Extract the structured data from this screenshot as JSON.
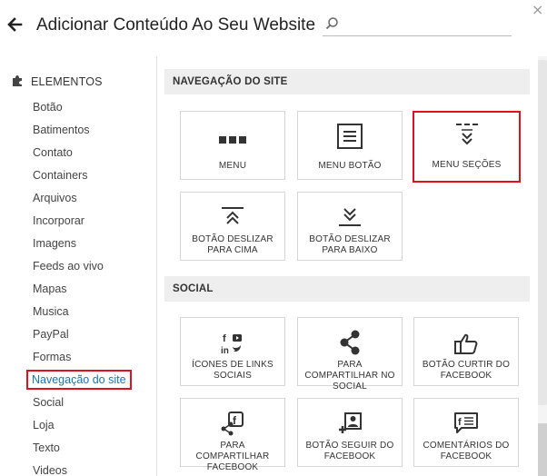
{
  "header": {
    "title": "Adicionar Conteúdo Ao Seu Website",
    "search_placeholder": "",
    "search_value": ""
  },
  "sidebar": {
    "header": "ELEMENTOS",
    "items": [
      {
        "label": "Botão"
      },
      {
        "label": "Batimentos"
      },
      {
        "label": "Contato"
      },
      {
        "label": "Containers"
      },
      {
        "label": "Arquivos"
      },
      {
        "label": "Incorporar"
      },
      {
        "label": "Imagens"
      },
      {
        "label": "Feeds ao vivo"
      },
      {
        "label": "Mapas"
      },
      {
        "label": "Musica"
      },
      {
        "label": "PayPal"
      },
      {
        "label": "Formas"
      },
      {
        "label": "Navegação do site",
        "active": true
      },
      {
        "label": "Social"
      },
      {
        "label": "Loja"
      },
      {
        "label": "Texto"
      },
      {
        "label": "Videos"
      }
    ]
  },
  "sections": {
    "nav": {
      "title": "NAVEGAÇÃO DO SITE",
      "cards": [
        {
          "label": "MENU",
          "icon": "menu-dots-icon"
        },
        {
          "label": "MENU BOTÃO",
          "icon": "menu-button-icon"
        },
        {
          "label": "MENU SEÇÕES",
          "icon": "menu-sections-icon"
        },
        {
          "label": "BOTÃO DESLIZAR PARA CIMA",
          "icon": "scroll-up-icon"
        },
        {
          "label": "BOTÃO DESLIZAR PARA BAIXO",
          "icon": "scroll-down-icon"
        }
      ]
    },
    "social": {
      "title": "SOCIAL",
      "cards": [
        {
          "label": "ÍCONES DE LINKS SOCIAIS",
          "icon": "social-links-icon"
        },
        {
          "label": "PARA COMPARTILHAR NO SOCIAL",
          "icon": "share-icon"
        },
        {
          "label": "BOTÃO CURTIR DO FACEBOOK",
          "icon": "thumbs-up-icon"
        },
        {
          "label": "PARA COMPARTILHAR FACEBOOK",
          "icon": "facebook-share-icon"
        },
        {
          "label": "BOTÃO SEGUIR DO FACEBOOK",
          "icon": "facebook-follow-icon"
        },
        {
          "label": "COMENTÁRIOS DO FACEBOOK",
          "icon": "facebook-comments-icon"
        }
      ]
    }
  },
  "colors": {
    "highlight": "#e0101d",
    "active_link": "#1a73b8",
    "section_bg": "#eeeeee"
  }
}
